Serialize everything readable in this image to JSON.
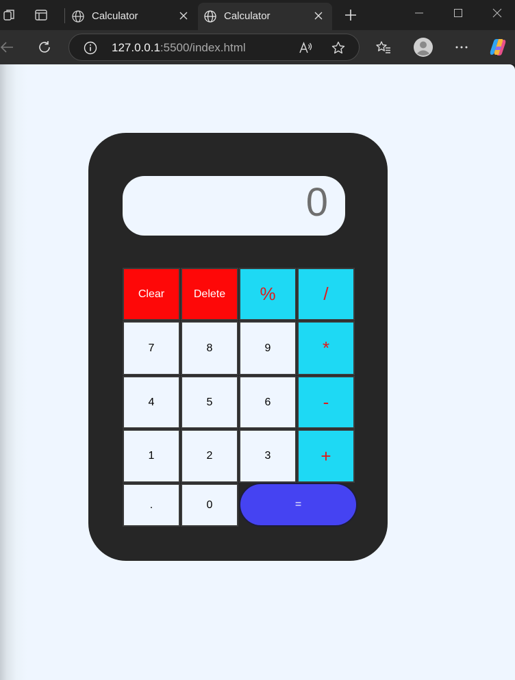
{
  "browser": {
    "tabs": [
      {
        "title": "Calculator",
        "active": false
      },
      {
        "title": "Calculator",
        "active": true
      }
    ],
    "url_host": "127.0.0.1",
    "url_rest": ":5500/index.html"
  },
  "calculator": {
    "display_value": "0",
    "keys": {
      "clear": "Clear",
      "delete": "Delete",
      "percent": "%",
      "divide": "/",
      "seven": "7",
      "eight": "8",
      "nine": "9",
      "multiply": "*",
      "four": "4",
      "five": "5",
      "six": "6",
      "subtract": "-",
      "one": "1",
      "two": "2",
      "three": "3",
      "add": "+",
      "decimal": ".",
      "zero": "0",
      "equals": "="
    }
  },
  "colors": {
    "page_background": "#eff6ff",
    "calculator_body": "#262626",
    "clear_delete_keys": "#fe0808",
    "operator_keys": "#1ed9f4",
    "operator_text": "#e01b1b",
    "equals_key": "#4543f2"
  },
  "icons": {
    "tab_strip": [
      "workspaces-icon",
      "tab-actions-icon"
    ],
    "toolbar": [
      "back-icon",
      "refresh-icon",
      "info-icon",
      "read-aloud-icon",
      "add-favorite-icon",
      "favorites-icon",
      "profile-icon",
      "more-icon",
      "copilot-icon"
    ]
  }
}
